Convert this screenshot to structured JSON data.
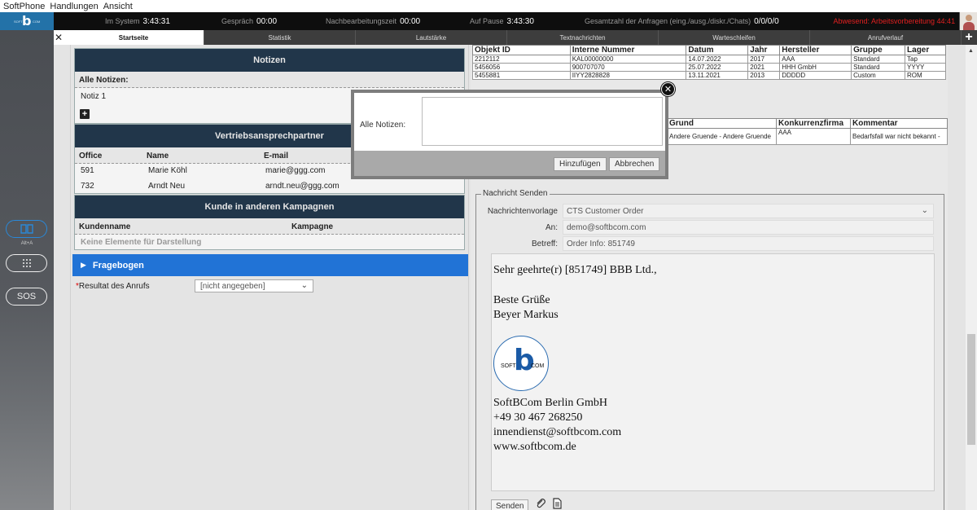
{
  "menu": [
    "SoftPhone",
    "Handlungen",
    "Ansicht"
  ],
  "status": {
    "system_label": "Im System",
    "system_value": "3:43:31",
    "call_label": "Gespräch",
    "call_value": "00:00",
    "post_label": "Nachbearbeitungszeit",
    "post_value": "00:00",
    "pause_label": "Auf Pause",
    "pause_value": "3:43:30",
    "total_label": "Gesamtzahl der Anfragen (eing./ausg./diskr./Chats)",
    "total_value": "0/0/0/0",
    "away_label": "Abwesend: Arbeitsvorbereitung",
    "away_value": "44:41"
  },
  "sidebar": {
    "alt_label": "Alt+A",
    "sos_label": "SOS"
  },
  "tabs": [
    "Startseite",
    "Statistik",
    "Lautstärke",
    "Textnachrichten",
    "Warteschleifen",
    "Anrufverlauf"
  ],
  "notes": {
    "title": "Notizen",
    "all_label": "Alle Notizen:",
    "items": [
      "Notiz 1"
    ]
  },
  "contacts": {
    "title": "Vertriebsansprechpartner",
    "headers": [
      "Office",
      "Name",
      "E-mail"
    ],
    "rows": [
      [
        "591",
        "Marie Köhl",
        "marie@ggg.com"
      ],
      [
        "732",
        "Arndt Neu",
        "arndt.neu@ggg.com"
      ]
    ]
  },
  "campaigns": {
    "title": "Kunde in anderen Kampagnen",
    "headers": [
      "Kundenname",
      "Kampagne"
    ],
    "empty": "Keine Elemente für Darstellung"
  },
  "fragebogen": "Fragebogen",
  "resultat": {
    "label": "Resultat des Anrufs",
    "required_mark": "*",
    "value": "[nicht angegeben]"
  },
  "objects": {
    "headers": [
      "Objekt ID",
      "Interne Nummer",
      "Datum",
      "Jahr",
      "Hersteller",
      "Gruppe",
      "Lager"
    ],
    "rows": [
      [
        "2212112",
        "KAL00000000",
        "14.07.2022",
        "2017",
        "AAA",
        "Standard",
        "Tap"
      ],
      [
        "5456056",
        "900707070",
        "25.07.2022",
        "2021",
        "HHH GmbH",
        "Standard",
        "YYYY"
      ],
      [
        "5455881",
        "IIYY2828828",
        "13.11.2021",
        "2013",
        "DDDDD",
        "Custom",
        "ROM"
      ]
    ]
  },
  "competitors": {
    "headers": [
      "Grund",
      "Konkurrenzfirma",
      "Kommentar"
    ],
    "rows": [
      [
        "Andere Gruende - Andere Gruende",
        "AAA",
        "Bedarfsfall war nicht bekannt -"
      ]
    ]
  },
  "message": {
    "legend": "Nachricht Senden",
    "template_label": "Nachrichtenvorlage",
    "template_value": "CTS Customer Order",
    "to_label": "An:",
    "to_value": "demo@softbcom.com",
    "subject_label": "Betreff:",
    "subject_value": "Order Info:  851749",
    "body": {
      "greeting": "Sehr geehrte(r) [851749] BBB Ltd.,",
      "closing": "Beste Grüße",
      "sender": "Beyer Markus",
      "logo_soft": "SOFT",
      "logo_b": "b",
      "logo_com": "COM",
      "company": "SoftBCom Berlin GmbH",
      "phone": "+49 30 467 268250",
      "email": "innendienst@softbcom.com",
      "web": "www.softbcom.de"
    },
    "send_label": "Senden"
  },
  "modal": {
    "label": "Alle Notizen:",
    "add_label": "Hinzufügen",
    "cancel_label": "Abbrechen"
  },
  "colors": {
    "section_header": "#21364a",
    "fragebogen": "#2173d6",
    "away": "#e02020",
    "logo_bg": "#2372a8"
  }
}
